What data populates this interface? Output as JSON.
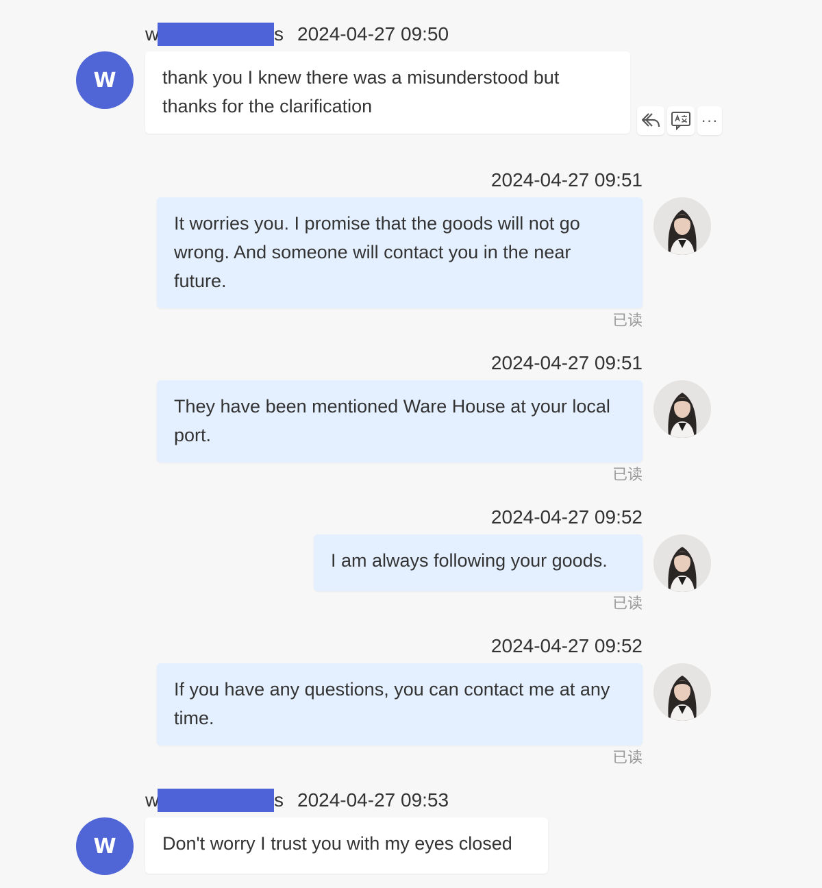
{
  "messages": [
    {
      "sender_prefix": "w",
      "sender_suffix": "s",
      "time": "2024-04-27 09:50",
      "avatar_letter": "W",
      "text": "thank you I knew there was a misunderstood but thanks for the clarification"
    },
    {
      "time": "2024-04-27 09:51",
      "text": "It worries you. I promise that the goods will not go wrong. And someone will contact you in the near future.",
      "status": "已读"
    },
    {
      "time": "2024-04-27 09:51",
      "text": "They have been mentioned Ware House at your local port.",
      "status": "已读"
    },
    {
      "time": "2024-04-27 09:52",
      "text": "I am always following your goods.",
      "status": "已读"
    },
    {
      "time": "2024-04-27 09:52",
      "text": "If you have any questions, you can contact me at any time.",
      "status": "已读"
    },
    {
      "sender_prefix": "w",
      "sender_suffix": "s",
      "time": "2024-04-27 09:53",
      "avatar_letter": "W",
      "text": "Don't worry I trust you with my eyes closed"
    }
  ],
  "message_actions": {
    "reply_icon": "reply-icon",
    "translate_icon": "translate-icon",
    "more_label": "···"
  },
  "colors": {
    "incoming_avatar": "#5066d6",
    "redaction": "#4f63d8",
    "outgoing_bubble": "#e4f0ff",
    "incoming_bubble": "#ffffff"
  }
}
